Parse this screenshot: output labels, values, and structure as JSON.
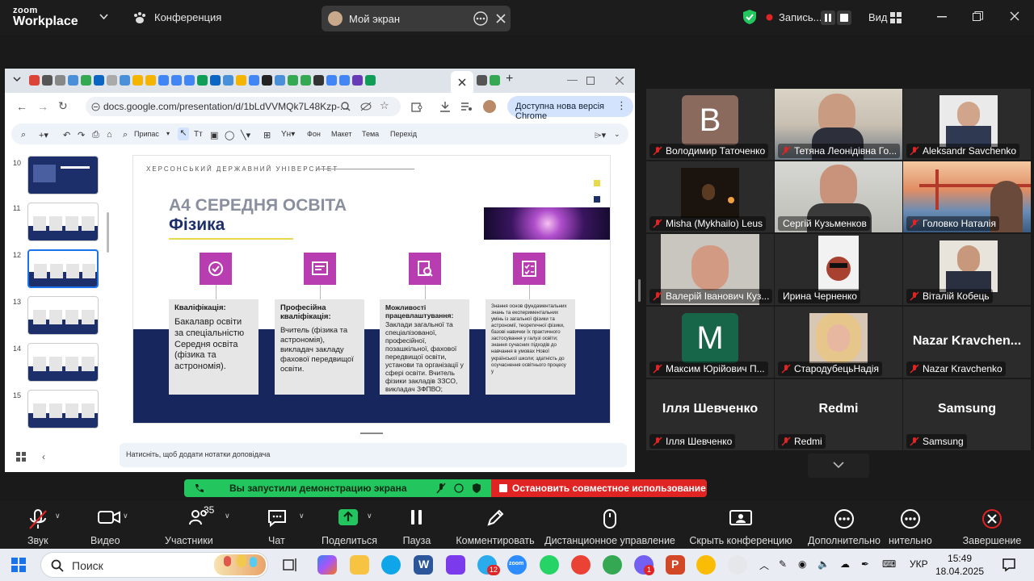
{
  "zoom": {
    "logo_top": "zoom",
    "logo_bottom": "Workplace",
    "meeting_menu": "Конференция",
    "screen_label": "Мой экран",
    "recording_label": "Запись...",
    "view_label": "Вид"
  },
  "browser": {
    "url": "docs.google.com/presentation/d/1bLdVVMQk7L48Kzp-...",
    "update_label": "Доступна нова версія Chrome",
    "toolbar": {
      "zoom": "Припас",
      "background": "Фон",
      "layout": "Макет",
      "theme": "Тема",
      "transition": "Перехід"
    },
    "thumb_numbers": [
      "10",
      "11",
      "12",
      "13",
      "14",
      "15"
    ],
    "notes_placeholder": "Натисніть, щоб додати нотатки доповідача"
  },
  "slide": {
    "university": "ХЕРСОНСЬКИЙ ДЕРЖАВНИЙ УНІВЕРСИТЕТ",
    "title_line1": "А4 СЕРЕДНЯ ОСВІТА",
    "title_line2": "Фізика",
    "cards": [
      {
        "title": "Кваліфікація:",
        "body": "Бакалавр освіти за спеціальністю Середня освіта (фізика та астрономія)."
      },
      {
        "title": "Професійна кваліфікація:",
        "body": "Вчитель (фізика та астрономія), викладач закладу фахової передвищої освіти."
      },
      {
        "title": "Можливості працевлаштування:",
        "body": "Заклади загальної та спеціалізованої, професійної, позашкільної, фахової передвищої освіти, установи та організації у сфері освіти. Вчитель фізики закладів ЗЗСО, викладач ЗФПВО;"
      },
      {
        "title": "",
        "body": "Знання основ фундаментальних знань та експериментальних умінь із загальної фізики та астрономії, теоретичної фізики, базові навички їх практичного застосування у галузі освіти; знання сучасних підходів до навчання в умовах Нової української школи; здатність до осучаснення освітнього процесу у"
      }
    ]
  },
  "participants": [
    {
      "name": "Володимир Таточенко",
      "avatar": "B",
      "avatar_color": "#8a6a5c"
    },
    {
      "name": "Тетяна Леонідівна Го...",
      "video": true
    },
    {
      "name": "Aleksandr Savchenko",
      "video": true
    },
    {
      "name": "Misha (Mykhailo) Leus",
      "video": true
    },
    {
      "name": "Сергій Кузьменков",
      "video": true
    },
    {
      "name": "Головко Наталія",
      "video": true
    },
    {
      "name": "Валерій Іванович Куз...",
      "video": true
    },
    {
      "name": "Ирина Черненко",
      "video": true
    },
    {
      "name": "Віталій Кобець",
      "video": true
    },
    {
      "name": "Максим Юрійович П...",
      "avatar": "M",
      "avatar_color": "#17664a"
    },
    {
      "name": "СтародубецьНадія",
      "video": true
    },
    {
      "name": "Nazar Kravchenko",
      "big_name": "Nazar  Kravchen..."
    },
    {
      "name": "Ілля Шевченко",
      "big_name": "Ілля Шевченко"
    },
    {
      "name": "Redmi",
      "big_name": "Redmi"
    },
    {
      "name": "Samsung",
      "big_name": "Samsung"
    }
  ],
  "share_notice": {
    "started": "Вы запустили демонстрацию экрана",
    "stop": "Остановить совместное использование"
  },
  "controls": [
    {
      "label": "Звук"
    },
    {
      "label": "Видео"
    },
    {
      "label": "Участники",
      "count": "35"
    },
    {
      "label": "Чат"
    },
    {
      "label": "Поделиться"
    },
    {
      "label": "Пауза"
    },
    {
      "label": "Комментировать"
    },
    {
      "label": "Дистанционное управление"
    },
    {
      "label": "Скрыть конференцию"
    },
    {
      "label": "Дополнительно"
    },
    {
      "label": "нительно"
    },
    {
      "label": "Завершение"
    }
  ],
  "taskbar": {
    "search_placeholder": "Поиск",
    "telegram_badge": "12",
    "viber_badge": "1",
    "lang": "УКР",
    "time": "15:49",
    "date": "18.04.2025"
  },
  "colors": {
    "accent_green": "#23c55e",
    "stop_red": "#e02424",
    "slide_navy": "#17275e",
    "slide_magenta": "#b73db1"
  }
}
